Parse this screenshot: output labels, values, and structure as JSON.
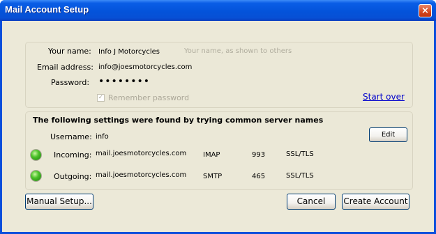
{
  "window": {
    "title": "Mail Account Setup",
    "close_glyph": "×"
  },
  "account": {
    "name_label": "Your name:",
    "name_value": "Info J Motorcycles",
    "name_placeholder": "Your name, as shown to others",
    "email_label": "Email address:",
    "email_value": "info@joesmotorcycles.com",
    "password_label": "Password:",
    "password_value": "••••••••",
    "remember_checked": true,
    "remember_label": "Remember password",
    "start_over_label": "Start over"
  },
  "settings": {
    "heading": "The following settings were found by trying common server names",
    "username_label": "Username:",
    "username_value": "info",
    "edit_label": "Edit",
    "incoming": {
      "label": "Incoming:",
      "server": "mail.joesmotorcycles.com",
      "protocol": "IMAP",
      "port": "993",
      "security": "SSL/TLS",
      "status_icon": "green-status-icon"
    },
    "outgoing": {
      "label": "Outgoing:",
      "server": "mail.joesmotorcycles.com",
      "protocol": "SMTP",
      "port": "465",
      "security": "SSL/TLS",
      "status_icon": "green-status-icon"
    }
  },
  "buttons": {
    "manual_setup": "Manual Setup...",
    "cancel": "Cancel",
    "create_account": "Create Account"
  },
  "colors": {
    "titlebar": "#0453da",
    "dialog_bg": "#ece9d8",
    "link": "#0000cc",
    "status_ok": "#4cc22a"
  }
}
